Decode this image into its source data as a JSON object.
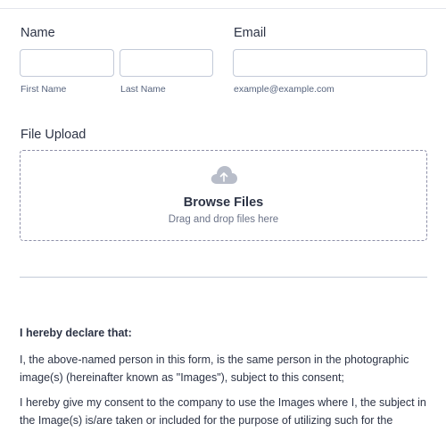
{
  "name_section": {
    "label": "Name",
    "first_name": {
      "value": "",
      "sublabel": "First Name"
    },
    "last_name": {
      "value": "",
      "sublabel": "Last Name"
    }
  },
  "email_section": {
    "label": "Email",
    "value": "",
    "sublabel": "example@example.com"
  },
  "upload_section": {
    "label": "File Upload",
    "icon": "cloud-upload-icon",
    "browse_label": "Browse Files",
    "hint": "Drag and drop files here"
  },
  "declaration": {
    "title": "I hereby declare that:",
    "paragraphs": [
      "I, the above-named person in this form, is the same person in the photographic image(s) (hereinafter known as \"Images\"), subject to this consent;",
      "I hereby give my consent to the company to use the Images where I, the subject in the Image(s) is/are taken or included for the purpose of utilizing such for the future..."
    ]
  },
  "colors": {
    "text": "#2c3345",
    "border": "#c3cad8",
    "dashed_border": "#8d8fa8",
    "icon": "#b8bdc9"
  }
}
